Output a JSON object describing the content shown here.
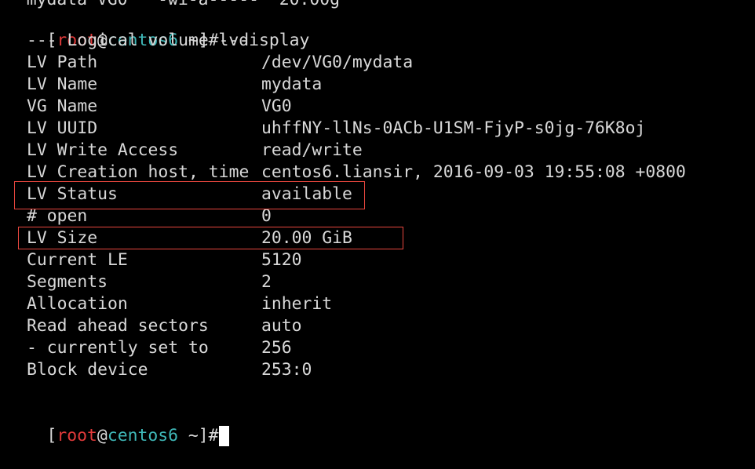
{
  "prev_line_fragment": "  mydata VG0   -wi-a-----  20.00g",
  "first_prompt": {
    "open_bracket": "[",
    "user": "root",
    "at": "@",
    "host": "centos6",
    "path": " ~",
    "close_bracket": "]#",
    "command": "lvdisplay"
  },
  "section_header": "--- Logical volume ---",
  "fields": [
    {
      "key": "LV Path",
      "value": "/dev/VG0/mydata"
    },
    {
      "key": "LV Name",
      "value": "mydata"
    },
    {
      "key": "VG Name",
      "value": "VG0"
    },
    {
      "key": "LV UUID",
      "value": "uhffNY-llNs-0ACb-U1SM-FjyP-s0jg-76K8oj"
    },
    {
      "key": "LV Write Access",
      "value": "read/write"
    },
    {
      "key": "LV Creation host, time",
      "value": "centos6.liansir, 2016-09-03 19:55:08 +0800"
    },
    {
      "key": "LV Status",
      "value": "available"
    },
    {
      "key": "# open",
      "value": "0"
    },
    {
      "key": "LV Size",
      "value": "20.00 GiB"
    },
    {
      "key": "Current LE",
      "value": "5120"
    },
    {
      "key": "Segments",
      "value": "2"
    },
    {
      "key": "Allocation",
      "value": "inherit"
    },
    {
      "key": "Read ahead sectors",
      "value": "auto"
    },
    {
      "key": "- currently set to",
      "value": "256"
    },
    {
      "key": "Block device",
      "value": "253:0"
    }
  ],
  "second_prompt": {
    "open_bracket": "[",
    "user": "root",
    "at": "@",
    "host": "centos6",
    "path": " ~",
    "close_bracket": "]#"
  },
  "colors": {
    "background": "#000000",
    "text": "#d8d8d8",
    "prompt_user": "#e03a3a",
    "prompt_host": "#3fb8b8",
    "highlight_box": "#e8463e",
    "cursor": "#ffffff"
  }
}
